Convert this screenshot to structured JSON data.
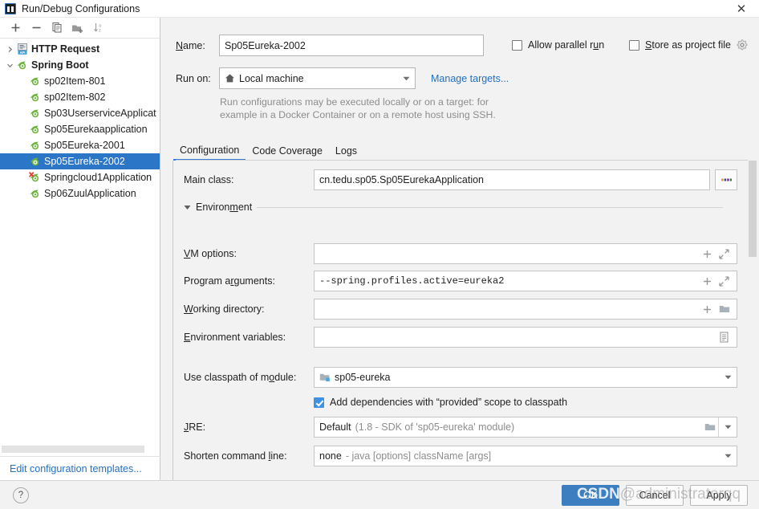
{
  "window": {
    "title": "Run/Debug Configurations",
    "app_icon": "intellij-idea-icon",
    "close_label": "✕"
  },
  "tree_toolbar": {
    "buttons": [
      {
        "name": "add-configuration-button",
        "icon": "plus-icon",
        "label": "+"
      },
      {
        "name": "remove-configuration-button",
        "icon": "minus-icon",
        "label": "−"
      },
      {
        "name": "copy-configuration-button",
        "icon": "copy-icon",
        "label": ""
      },
      {
        "name": "save-configuration-button",
        "icon": "folder-plus-icon",
        "label": ""
      },
      {
        "name": "sort-configurations-button",
        "icon": "sort-alphabetical-icon",
        "label": ""
      }
    ]
  },
  "tree": {
    "items": [
      {
        "label": "HTTP Request",
        "icon": "api-request-icon",
        "level": 0,
        "group": true,
        "expanded": false,
        "selected": false,
        "error": false
      },
      {
        "label": "Spring Boot",
        "icon": "spring-boot-icon",
        "level": 0,
        "group": true,
        "expanded": true,
        "selected": false,
        "error": false
      },
      {
        "label": "sp02Item-801",
        "icon": "spring-boot-icon",
        "level": 1,
        "group": false,
        "selected": false,
        "error": false
      },
      {
        "label": "sp02Item-802",
        "icon": "spring-boot-icon",
        "level": 1,
        "group": false,
        "selected": false,
        "error": false
      },
      {
        "label": "Sp03UserserviceApplicat",
        "icon": "spring-boot-icon",
        "level": 1,
        "group": false,
        "selected": false,
        "error": false
      },
      {
        "label": "Sp05Eurekaapplication",
        "icon": "spring-boot-icon",
        "level": 1,
        "group": false,
        "selected": false,
        "error": false
      },
      {
        "label": "Sp05Eureka-2001",
        "icon": "spring-boot-icon",
        "level": 1,
        "group": false,
        "selected": false,
        "error": false
      },
      {
        "label": "Sp05Eureka-2002",
        "icon": "spring-boot-icon",
        "level": 1,
        "group": false,
        "selected": true,
        "error": false
      },
      {
        "label": "Springcloud1Application",
        "icon": "spring-boot-error-icon",
        "level": 1,
        "group": false,
        "selected": false,
        "error": true
      },
      {
        "label": "Sp06ZuulApplication",
        "icon": "spring-boot-icon",
        "level": 1,
        "group": false,
        "selected": false,
        "error": false
      }
    ],
    "edit_templates_link": "Edit configuration templates..."
  },
  "form": {
    "name_label": "Name:",
    "name_mnemonic": "N",
    "name_value": "Sp05Eureka-2002",
    "allow_parallel_run": {
      "label": "Allow parallel run",
      "checked": false
    },
    "store_as_project_file": {
      "label": "Store as project file",
      "checked": false,
      "gear_icon": "gear-icon"
    },
    "run_on_label": "Run on:",
    "run_on_value": "Local machine",
    "run_on_icon": "home-icon",
    "manage_targets_link": "Manage targets...",
    "hint_line1": "Run configurations may be executed locally or on a target: for",
    "hint_line2": "example in a Docker Container or on a remote host using SSH."
  },
  "tabs": [
    {
      "label": "Configuration",
      "active": true
    },
    {
      "label": "Code Coverage",
      "active": false
    },
    {
      "label": "Logs",
      "active": false
    }
  ],
  "configuration": {
    "main_class": {
      "label": "Main class:",
      "value": "cn.tedu.sp05.Sp05EurekaApplication",
      "browse_icon": "ellipsis-icon"
    },
    "environment_section": {
      "label": "Environment",
      "mnemonic": "m",
      "expanded": true
    },
    "vm_options": {
      "label": "VM options:",
      "mnemonic": "V",
      "value": "",
      "icons": [
        "plus-icon",
        "expand-icon"
      ]
    },
    "program_arguments": {
      "label": "Program arguments:",
      "mnemonic": "r",
      "value": "--spring.profiles.active=eureka2",
      "icons": [
        "plus-icon",
        "expand-icon"
      ]
    },
    "working_directory": {
      "label": "Working directory:",
      "mnemonic": "W",
      "value": "",
      "icons": [
        "plus-icon",
        "folder-icon"
      ]
    },
    "environment_variables": {
      "label": "Environment variables:",
      "mnemonic": "E",
      "value": "",
      "icons": [
        "list-icon"
      ]
    },
    "use_classpath_of_module": {
      "label": "Use classpath of module:",
      "mnemonic": "o",
      "value": "sp05-eureka",
      "icon": "module-folder-icon"
    },
    "add_dependencies": {
      "label": "Add dependencies with “provided” scope to classpath",
      "checked": true
    },
    "jre": {
      "label": "JRE:",
      "mnemonic": "J",
      "value": "Default",
      "description": "(1.8 - SDK of 'sp05-eureka' module)",
      "icons": [
        "folder-icon",
        "chevron-down-icon"
      ]
    },
    "shorten_command_line": {
      "label": "Shorten command line:",
      "mnemonic": "l",
      "value": "none",
      "description": "- java [options] className [args]",
      "icons": [
        "chevron-down-icon"
      ]
    }
  },
  "footer": {
    "help_label": "?",
    "ok_label": "OK",
    "cancel_label": "Cancel",
    "apply_label": "Apply"
  },
  "watermark": {
    "brand": "CSDN",
    "handle": "@administratorqq"
  },
  "colors": {
    "accent": "#2c76c7",
    "primary_button": "#3c7ebf",
    "link": "#2470c0",
    "checkbox_on": "#3d92e3",
    "tab_underline": "#3b7dd8",
    "hint_text": "#8d8d8d"
  }
}
